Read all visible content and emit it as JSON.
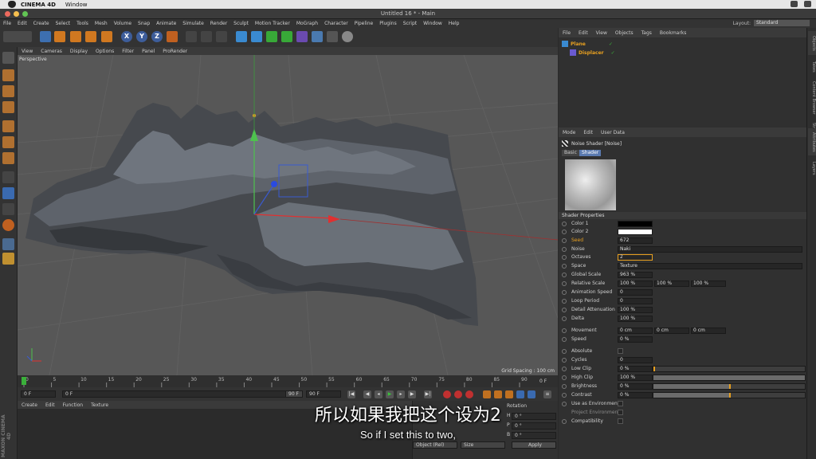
{
  "mac": {
    "app_name": "CINEMA 4D",
    "window_menu": "Window"
  },
  "window": {
    "title": "Untitled 16 * - Main"
  },
  "menubar": [
    "File",
    "Edit",
    "Create",
    "Select",
    "Tools",
    "Mesh",
    "Volume",
    "Snap",
    "Animate",
    "Simulate",
    "Render",
    "Sculpt",
    "Motion Tracker",
    "MoGraph",
    "Character",
    "Pipeline",
    "Plugins",
    "Script",
    "Window",
    "Help"
  ],
  "layout": {
    "label": "Layout:",
    "value": "Standard"
  },
  "toolbar": {
    "x": "X",
    "y": "Y",
    "z": "Z"
  },
  "viewport": {
    "menu": [
      "View",
      "Cameras",
      "Display",
      "Options",
      "Filter",
      "Panel",
      "ProRender"
    ],
    "label": "Perspective",
    "grid_spacing": "Grid Spacing : 100 cm"
  },
  "timeline": {
    "ticks": [
      "0",
      "5",
      "10",
      "15",
      "20",
      "25",
      "30",
      "35",
      "40",
      "45",
      "50",
      "55",
      "60",
      "65",
      "70",
      "75",
      "80",
      "85",
      "90"
    ],
    "end_frame": "0 F"
  },
  "transport": {
    "current": "0 F",
    "start": "0 F",
    "end": "90 F",
    "end2": "90 F"
  },
  "materials": {
    "menu": [
      "Create",
      "Edit",
      "Function",
      "Texture"
    ]
  },
  "coords": {
    "header": "Rotation",
    "rows": [
      {
        "label": "H",
        "value": "0 °"
      },
      {
        "label": "P",
        "value": "0 °"
      },
      {
        "label": "B",
        "value": "0 °"
      }
    ],
    "mode": "Object (Rel)",
    "size": "Size",
    "apply": "Apply"
  },
  "maxon": "MAXON CINEMA 4D",
  "objects": {
    "menu": [
      "File",
      "Edit",
      "View",
      "Objects",
      "Tags",
      "Bookmarks"
    ],
    "items": [
      {
        "name": "Plane",
        "color": "#e8a020"
      },
      {
        "name": "Displacer",
        "color": "#e8a020"
      }
    ]
  },
  "attributes": {
    "menu": [
      "Mode",
      "Edit",
      "User Data"
    ],
    "header": "Noise Shader [Noise]",
    "tabs": [
      "Basic",
      "Shader"
    ],
    "section": "Shader Properties",
    "color1_label": "Color 1",
    "color2_label": "Color 2",
    "seed": {
      "label": "Seed",
      "value": "672"
    },
    "noise": {
      "label": "Noise",
      "value": "Naki"
    },
    "octaves": {
      "label": "Octaves",
      "value": "2"
    },
    "space": {
      "label": "Space",
      "value": "Texture"
    },
    "global_scale": {
      "label": "Global Scale",
      "value": "963 %"
    },
    "relative_scale": {
      "label": "Relative Scale",
      "v1": "100 %",
      "v2": "100 %",
      "v3": "100 %"
    },
    "animation_speed": {
      "label": "Animation Speed",
      "value": "0"
    },
    "loop_period": {
      "label": "Loop Period",
      "value": "0"
    },
    "detail_attenuation": {
      "label": "Detail Attenuation",
      "value": "100 %"
    },
    "delta": {
      "label": "Delta",
      "value": "100 %"
    },
    "movement": {
      "label": "Movement",
      "v1": "0 cm",
      "v2": "0 cm",
      "v3": "0 cm"
    },
    "speed": {
      "label": "Speed",
      "value": "0 %"
    },
    "absolute": {
      "label": "Absolute"
    },
    "cycles": {
      "label": "Cycles",
      "value": "0"
    },
    "low_clip": {
      "label": "Low Clip",
      "value": "0 %"
    },
    "high_clip": {
      "label": "High Clip",
      "value": "100 %"
    },
    "brightness": {
      "label": "Brightness",
      "value": "0 %"
    },
    "contrast": {
      "label": "Contrast",
      "value": "0 %"
    },
    "use_as_environment": {
      "label": "Use as Environment"
    },
    "project_environment": {
      "label": "Project Environment"
    },
    "compatibility": {
      "label": "Compatibility"
    }
  },
  "right_tabs": [
    "Objects",
    "Takes",
    "Content Browser",
    "Structure",
    "Attributes",
    "Layers"
  ],
  "subtitles": {
    "cn": "所以如果我把这个设为2",
    "en": "So if I set this to two,"
  }
}
